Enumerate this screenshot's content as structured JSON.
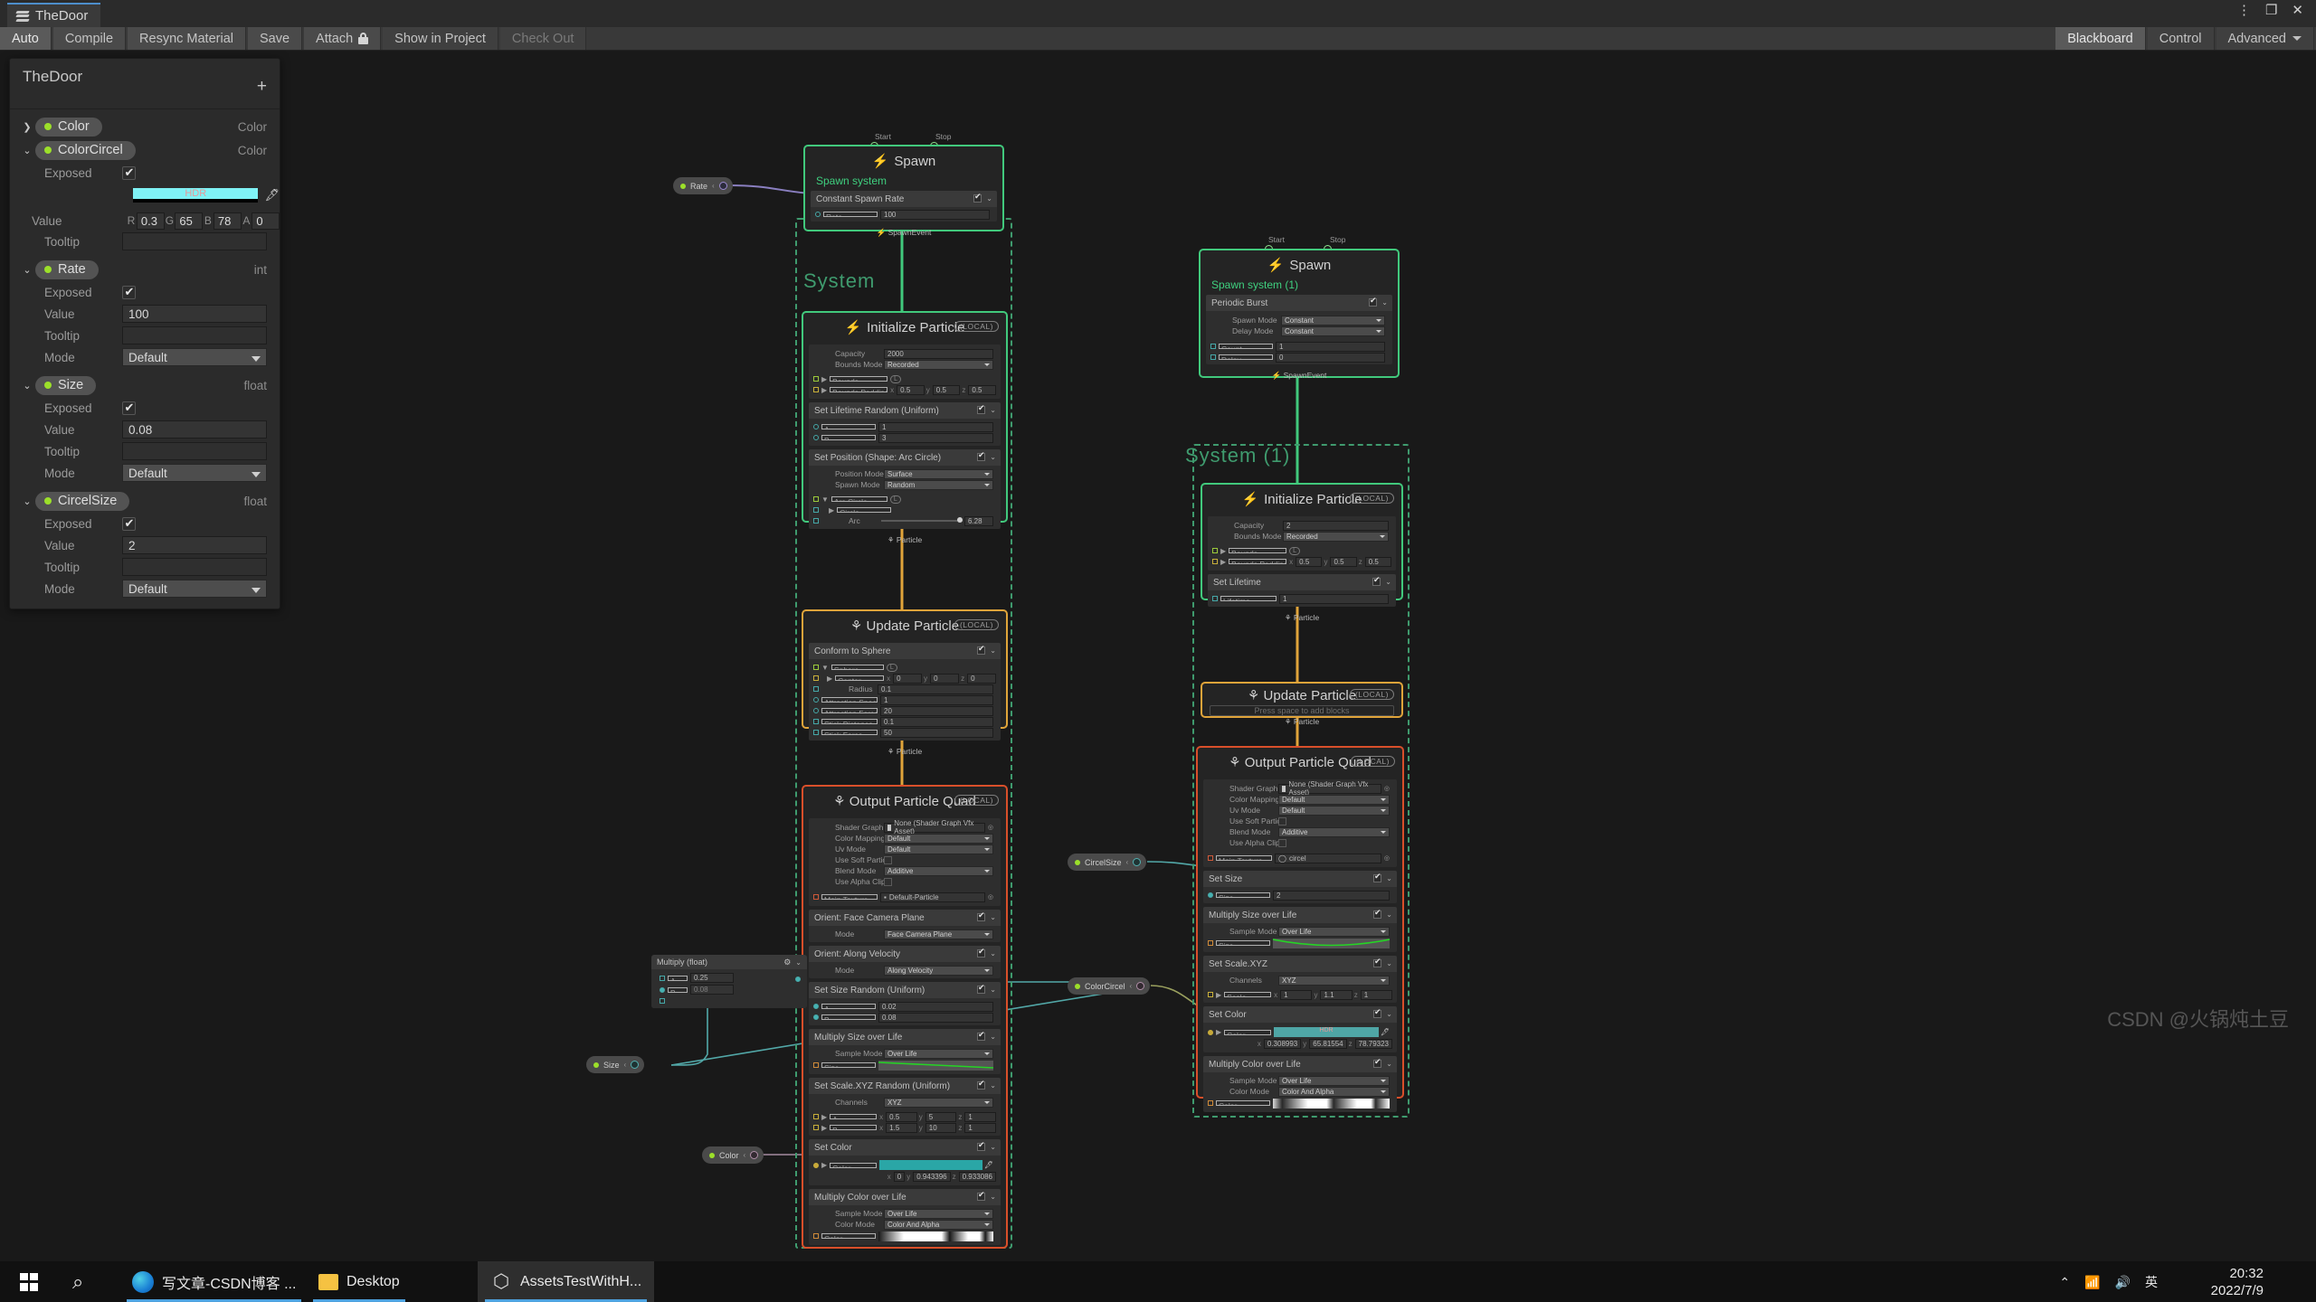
{
  "window": {
    "tab_title": "TheDoor",
    "logo_icon": "vfx-graph-logo-icon",
    "menu_icon": "kebab-menu-icon",
    "maximize_icon": "maximize-icon",
    "close_icon": "close-icon"
  },
  "toolbar": {
    "left": [
      {
        "label": "Auto",
        "state": "selected"
      },
      {
        "label": "Compile",
        "state": "normal"
      },
      {
        "label": "Resync Material",
        "state": "normal"
      },
      {
        "label": "Save",
        "state": "normal"
      },
      {
        "label": "Attach",
        "state": "normal",
        "icon": "lock-icon"
      },
      {
        "label": "Show in Project",
        "state": "plain"
      },
      {
        "label": "Check Out",
        "state": "disabled"
      }
    ],
    "right": [
      {
        "label": "Blackboard",
        "state": "selected"
      },
      {
        "label": "Control",
        "state": "plain"
      },
      {
        "label": "Advanced",
        "state": "plain",
        "icon": "chevron-down-icon"
      }
    ]
  },
  "blackboard": {
    "title": "TheDoor",
    "add_label": "+",
    "properties": [
      {
        "name": "Color",
        "type": "Color",
        "expanded": false,
        "fields": []
      },
      {
        "name": "ColorCircel",
        "type": "Color",
        "expanded": true,
        "exposed_label": "Exposed",
        "exposed": true,
        "value_label": "Value",
        "color_swatch": "#7ff2f5",
        "hdr_label": "HDR",
        "rgba": [
          {
            "label": "R",
            "value": "0.3"
          },
          {
            "label": "G",
            "value": "65"
          },
          {
            "label": "B",
            "value": "78"
          },
          {
            "label": "A",
            "value": "0"
          }
        ],
        "tooltip_label": "Tooltip",
        "tooltip": ""
      },
      {
        "name": "Rate",
        "type": "int",
        "expanded": true,
        "exposed_label": "Exposed",
        "exposed": true,
        "value_label": "Value",
        "value": "100",
        "tooltip_label": "Tooltip",
        "tooltip": "",
        "mode_label": "Mode",
        "mode": "Default"
      },
      {
        "name": "Size",
        "type": "float",
        "expanded": true,
        "exposed_label": "Exposed",
        "exposed": true,
        "value_label": "Value",
        "value": "0.08",
        "tooltip_label": "Tooltip",
        "tooltip": "",
        "mode_label": "Mode",
        "mode": "Default"
      },
      {
        "name": "CircelSize",
        "type": "float",
        "expanded": true,
        "exposed_label": "Exposed",
        "exposed": true,
        "value_label": "Value",
        "value": "2",
        "tooltip_label": "Tooltip",
        "tooltip": "",
        "mode_label": "Mode",
        "mode": "Default"
      }
    ]
  },
  "graph": {
    "spawn_a": {
      "start_label": "Start",
      "stop_label": "Stop",
      "header": "Spawn",
      "system_name": "Spawn system",
      "block": "Constant Spawn Rate",
      "rate_label": "Rate",
      "rate_value": "100",
      "out_label": "SpawnEvent"
    },
    "spawn_b": {
      "start_label": "Start",
      "stop_label": "Stop",
      "header": "Spawn",
      "system_name": "Spawn system (1)",
      "block": "Periodic Burst",
      "spawn_mode_label": "Spawn Mode",
      "spawn_mode": "Constant",
      "delay_mode_label": "Delay Mode",
      "delay_mode": "Constant",
      "count_label": "Count",
      "count_value": "1",
      "delay_label": "Delay",
      "delay_value": "0",
      "out_label": "SpawnEvent"
    },
    "system_left": {
      "label": "System",
      "color": "#3f9b6e"
    },
    "system_right": {
      "label": "System (1)",
      "color": "#3f9b6e"
    },
    "init_left": {
      "header": "Initialize Particle",
      "badge": "(LOCAL)",
      "capacity_label": "Capacity",
      "capacity": "2000",
      "bounds_mode_label": "Bounds Mode",
      "bounds_mode": "Recorded",
      "bounds_label": "Bounds",
      "bounds_padding_label": "Bounds Padding",
      "bounds_padding": {
        "x": "0.5",
        "y": "0.5",
        "z": "0.5"
      },
      "lifetime_block": "Set Lifetime Random (Uniform)",
      "a_label": "A",
      "a_value": "1",
      "b_label": "B",
      "b_value": "3",
      "position_block": "Set Position (Shape: Arc Circle)",
      "position_mode_label": "Position Mode",
      "position_mode": "Surface",
      "spawn_mode_label": "Spawn Mode",
      "spawn_mode": "Random",
      "arc_circle_label": "Arc Circle",
      "circle_label": "Circle",
      "arc_label": "Arc",
      "arc_value": "6.28",
      "flow_out": "Particle"
    },
    "update_left": {
      "header": "Update Particle",
      "badge": "(LOCAL)",
      "block": "Conform to Sphere",
      "sphere_label": "Sphere",
      "center_label": "Center",
      "center": {
        "x": "0",
        "y": "0",
        "z": "0"
      },
      "radius_label": "Radius",
      "radius": "0.1",
      "attraction_speed_label": "Attraction Speed",
      "attraction_speed": "1",
      "attraction_force_label": "Attraction Force",
      "attraction_force": "20",
      "stick_distance_label": "Stick Distance",
      "stick_distance": "0.1",
      "stick_force_label": "Stick Force",
      "stick_force": "50",
      "flow_out": "Particle"
    },
    "output_left": {
      "header": "Output Particle Quad",
      "badge": "(LOCAL)",
      "shader_graph_label": "Shader Graph",
      "shader_graph": "None (Shader Graph Vfx Asset)",
      "color_mapping_label": "Color Mapping",
      "color_mapping": "Default",
      "uv_mode_label": "Uv Mode",
      "uv_mode": "Default",
      "use_soft_particle_label": "Use Soft Particle",
      "blend_mode_label": "Blend Mode",
      "blend_mode": "Additive",
      "use_alpha_clipping_label": "Use Alpha Clipping",
      "main_texture_label": "Main Texture",
      "main_texture": "Default-Particle",
      "orient_face_block": "Orient: Face Camera Plane",
      "orient_face_mode_label": "Mode",
      "orient_face_mode": "Face Camera Plane",
      "orient_vel_block": "Orient: Along Velocity",
      "orient_vel_mode_label": "Mode",
      "orient_vel_mode": "Along Velocity",
      "size_block": "Set Size Random (Uniform)",
      "size_a_label": "A",
      "size_a": "0.02",
      "size_b_label": "B",
      "size_b": "0.08",
      "mul_size_block": "Multiply Size over Life",
      "mul_size_sample_label": "Sample Mode",
      "mul_size_sample": "Over Life",
      "mul_size_curve_label": "Size",
      "scale_block": "Set Scale.XYZ Random (Uniform)",
      "channels_label": "Channels",
      "channels": "XYZ",
      "scale_a_label": "A",
      "scale_a": {
        "x": "0.5",
        "y": "5",
        "z": "1"
      },
      "scale_b_label": "B",
      "scale_b": {
        "x": "1.5",
        "y": "10",
        "z": "1"
      },
      "set_color_block": "Set Color",
      "color_label": "Color",
      "color_swatch": "#2aa6a6",
      "color_rgb": {
        "x": "0",
        "y": "0.943396",
        "z": "0.933086"
      },
      "mul_color_block": "Multiply Color over Life",
      "mul_color_sample_label": "Sample Mode",
      "mul_color_sample": "Over Life",
      "mul_color_mode_label": "Color Mode",
      "mul_color_mode": "Color And Alpha",
      "mul_color_grad_label": "Color"
    },
    "init_right": {
      "header": "Initialize Particle",
      "badge": "(LOCAL)",
      "capacity_label": "Capacity",
      "capacity": "2",
      "bounds_mode_label": "Bounds Mode",
      "bounds_mode": "Recorded",
      "bounds_label": "Bounds",
      "bounds_padding_label": "Bounds Padding",
      "bounds_padding": {
        "x": "0.5",
        "y": "0.5",
        "z": "0.5"
      },
      "lifetime_block": "Set Lifetime",
      "lifetime_label": "Lifetime",
      "lifetime": "1",
      "flow_out": "Particle"
    },
    "update_right": {
      "header": "Update Particle",
      "badge": "(LOCAL)",
      "empty_hint": "Press space to add blocks",
      "flow_out": "Particle"
    },
    "output_right": {
      "header": "Output Particle Quad",
      "badge": "(LOCAL)",
      "shader_graph_label": "Shader Graph",
      "shader_graph": "None (Shader Graph Vfx Asset)",
      "color_mapping_label": "Color Mapping",
      "color_mapping": "Default",
      "uv_mode_label": "Uv Mode",
      "uv_mode": "Default",
      "use_soft_particle_label": "Use Soft Particle",
      "blend_mode_label": "Blend Mode",
      "blend_mode": "Additive",
      "use_alpha_clipping_label": "Use Alpha Clipping",
      "main_texture_label": "Main Texture",
      "main_texture": "circel",
      "size_block": "Set Size",
      "size_label": "Size",
      "size_value": "2",
      "mul_size_block": "Multiply Size over Life",
      "mul_size_sample_label": "Sample Mode",
      "mul_size_sample": "Over Life",
      "mul_size_curve_label": "Size",
      "scale_block": "Set Scale.XYZ",
      "channels_label": "Channels",
      "channels": "XYZ",
      "scale_label": "Scale",
      "scale": {
        "x": "1",
        "y": "1.1",
        "z": "1"
      },
      "set_color_block": "Set Color",
      "color_label": "Color",
      "color_swatch": "#4fa6a6",
      "hdr_label": "HDR",
      "color_rgb": {
        "x": "0.308993",
        "y": "65.81554",
        "z": "78.79323"
      },
      "mul_color_block": "Multiply Color over Life",
      "mul_color_sample_label": "Sample Mode",
      "mul_color_sample": "Over Life",
      "mul_color_mode_label": "Color Mode",
      "mul_color_mode": "Color And Alpha",
      "mul_color_grad_label": "Color"
    },
    "prop_nodes": [
      {
        "id": "rate",
        "name": "Rate"
      },
      {
        "id": "size",
        "name": "Size"
      },
      {
        "id": "color",
        "name": "Color"
      },
      {
        "id": "circelsize",
        "name": "CircelSize"
      },
      {
        "id": "colorcircel",
        "name": "ColorCircel"
      }
    ],
    "multiply_node": {
      "title": "Multiply (float)",
      "a_label": "A",
      "a_value": "0.25",
      "b_label": "B",
      "b_value": "0.08",
      "gear_icon": "gear-icon"
    }
  },
  "taskbar": {
    "start_icon": "windows-start-icon",
    "search_icon": "search-icon",
    "items": [
      {
        "label": "写文章-CSDN博客 ...",
        "icon": "edge-icon",
        "active": false
      },
      {
        "label": "Desktop",
        "icon": "folder-icon",
        "active": false
      },
      {
        "label": "AssetsTestWithH...",
        "icon": "unity-icon",
        "active": true
      }
    ],
    "tray": [
      "chevron-up-icon",
      "network-icon",
      "volume-icon",
      "ime-icon"
    ],
    "ime_label": "英",
    "clock_time": "20:32",
    "clock_date": "2022/7/9"
  },
  "watermark": "CSDN @火锅炖土豆"
}
